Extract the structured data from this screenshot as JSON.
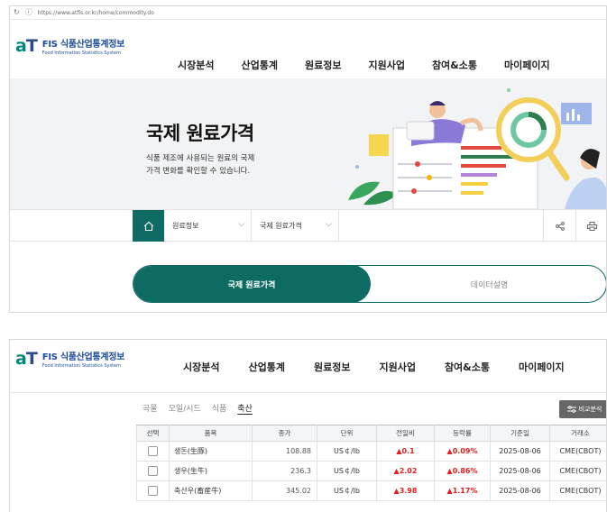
{
  "browser": {
    "url": "https://www.atfis.or.kr/home/commodity.do"
  },
  "logo": {
    "mark": "aT",
    "title": "FIS 식품산업통계정보",
    "subtitle": "Food Information Statistics System"
  },
  "nav": [
    "시장분석",
    "산업통계",
    "원료정보",
    "지원사업",
    "참여&소통",
    "마이페이지"
  ],
  "hero": {
    "title": "국제 원료가격",
    "desc_line1": "식품 제조에 사용되는 원료의 국제",
    "desc_line2": "가격 변화를 확인할 수 있습니다."
  },
  "subnav": {
    "crumb1": "원료정보",
    "crumb2": "국제 원료가격"
  },
  "tabs": {
    "active": "국제 원료가격",
    "inactive": "데이터설명"
  },
  "categories": [
    {
      "label": "곡물",
      "active": false
    },
    {
      "label": "오일/시드",
      "active": false
    },
    {
      "label": "식품",
      "active": false
    },
    {
      "label": "축산",
      "active": true
    }
  ],
  "compare_button": "비교분석",
  "table": {
    "headers": [
      "선택",
      "품목",
      "종가",
      "단위",
      "전일비",
      "등락률",
      "기준일",
      "거래소"
    ],
    "rows": [
      {
        "name": "생돈(生豚)",
        "price": "108.88",
        "unit": "US￠/lb",
        "change": "▲0.1",
        "rate": "▲0.09%",
        "date": "2025-08-06",
        "exchange": "CME(CBOT)"
      },
      {
        "name": "생우(生牛)",
        "price": "236.3",
        "unit": "US￠/lb",
        "change": "▲2.02",
        "rate": "▲0.86%",
        "date": "2025-08-06",
        "exchange": "CME(CBOT)"
      },
      {
        "name": "축산우(畜産牛)",
        "price": "345.02",
        "unit": "US￠/lb",
        "change": "▲3.98",
        "rate": "▲1.17%",
        "date": "2025-08-06",
        "exchange": "CME(CBOT)"
      }
    ]
  },
  "colors": {
    "primary": "#0e6b63",
    "brand_blue": "#1d4b9c",
    "up_red": "#e02020"
  }
}
